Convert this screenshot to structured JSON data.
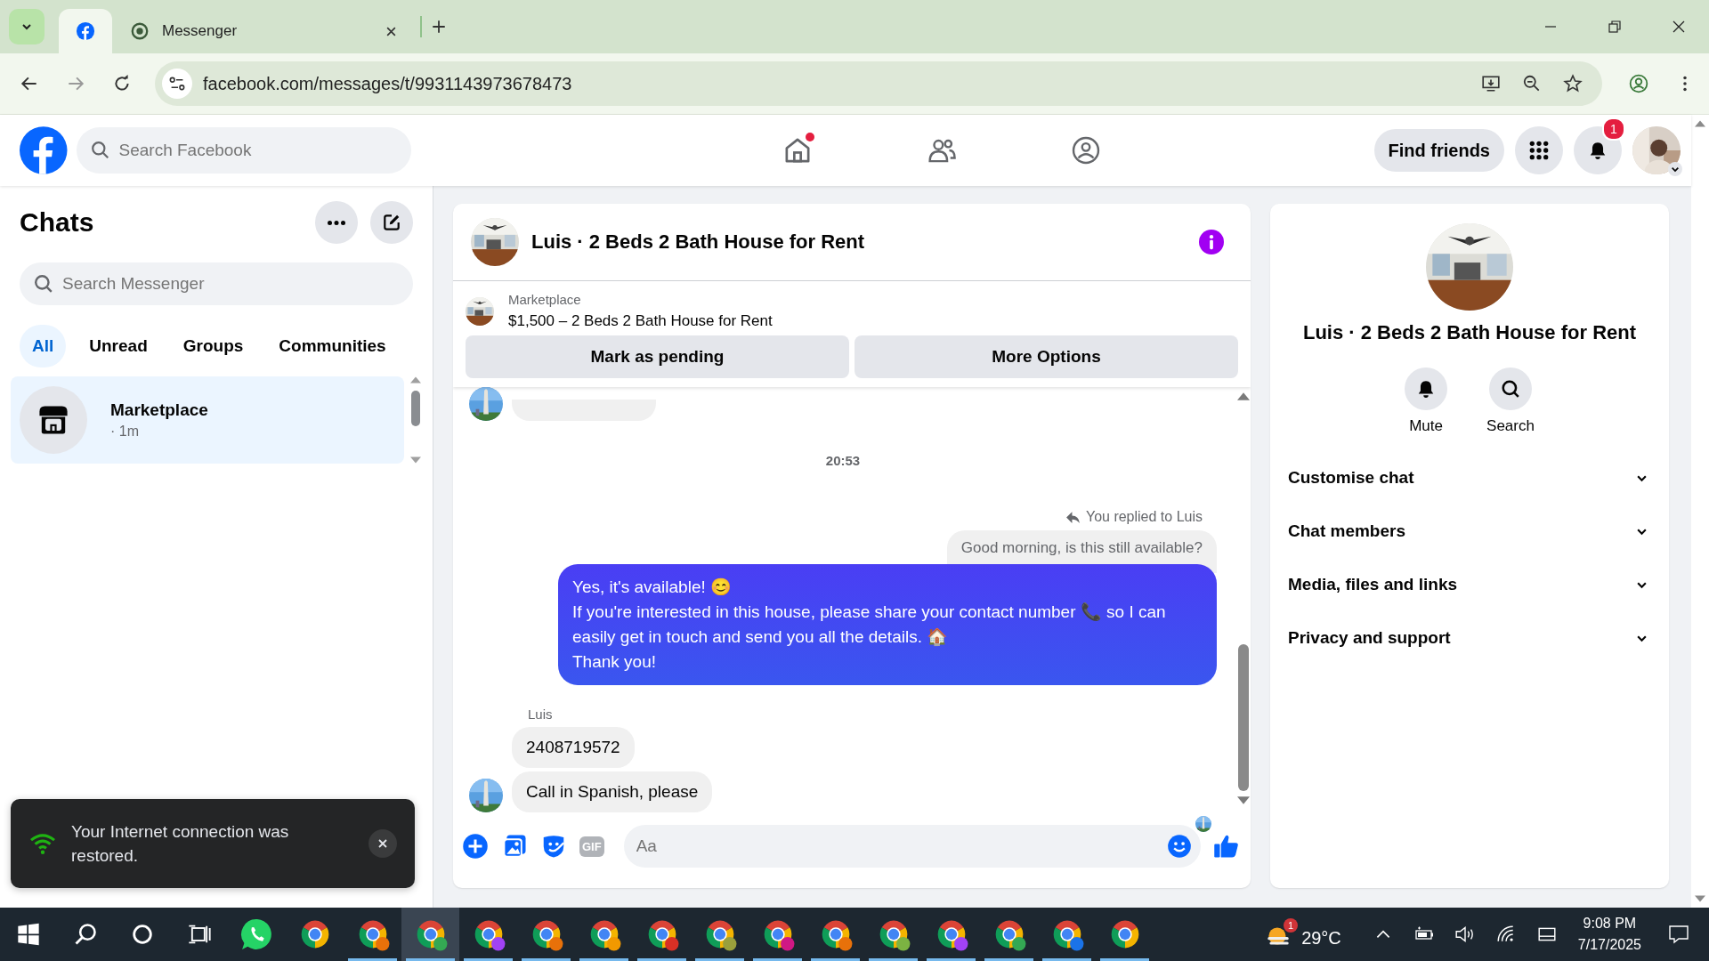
{
  "browser": {
    "tabs": [
      {
        "kind": "facebook",
        "selected": true
      },
      {
        "kind": "messenger",
        "label": "Messenger",
        "selected": false
      }
    ],
    "url": "facebook.com/messages/t/9931143973678473"
  },
  "header": {
    "search_placeholder": "Search Facebook",
    "nav": [
      {
        "kind": "home",
        "dot": true
      },
      {
        "kind": "friends",
        "dot": false
      },
      {
        "kind": "groups",
        "dot": false
      }
    ],
    "find_friends": "Find friends",
    "notification_count": "1"
  },
  "chats": {
    "title": "Chats",
    "search_placeholder": "Search Messenger",
    "filters": [
      {
        "label": "All",
        "selected": true
      },
      {
        "label": "Unread",
        "selected": false
      },
      {
        "label": "Groups",
        "selected": false
      },
      {
        "label": "Communities",
        "selected": false
      }
    ],
    "conversations": [
      {
        "name": "Marketplace",
        "time": "· 1m",
        "selected": true
      }
    ]
  },
  "toast": {
    "text": "Your Internet connection was restored."
  },
  "conversation": {
    "title": "Luis · 2 Beds 2 Bath House for Rent",
    "listing": {
      "source": "Marketplace",
      "title": "$1,500 – 2 Beds 2 Bath House for Rent"
    },
    "actions": [
      "Mark as pending",
      "More Options"
    ],
    "timestamp": "20:53",
    "reply_note": "You replied to Luis",
    "quoted": "Good morning, is this still available?",
    "sent": [
      "Yes, it's available! 😊",
      "If you're interested in this house, please share your contact number 📞 so I can easily get in touch and send you all the details. 🏠",
      "Thank you!"
    ],
    "sender": "Luis",
    "received": [
      "2408719572",
      "Call in Spanish, please"
    ],
    "composer_placeholder": "Aa",
    "gif_label": "GIF"
  },
  "details": {
    "title": "Luis · 2 Beds 2 Bath House for Rent",
    "actions": [
      {
        "kind": "mute",
        "label": "Mute"
      },
      {
        "kind": "search",
        "label": "Search"
      }
    ],
    "sections": [
      "Customise chat",
      "Chat members",
      "Media, files and links",
      "Privacy and support"
    ]
  },
  "taskbar": {
    "apps": [
      {
        "kind": "whatsapp",
        "open": false,
        "selected": false
      },
      {
        "kind": "chrome",
        "open": false,
        "selected": false
      },
      {
        "kind": "chrome",
        "color": "#e8710a",
        "open": true,
        "selected": false
      },
      {
        "kind": "chrome",
        "color": "#34a853",
        "open": true,
        "selected": true
      },
      {
        "kind": "chrome",
        "color": "#a142f4",
        "open": true,
        "selected": false
      },
      {
        "kind": "chrome",
        "color": "#e8710a",
        "open": true,
        "selected": false
      },
      {
        "kind": "chrome",
        "color": "#f29900",
        "open": true,
        "selected": false
      },
      {
        "kind": "chrome",
        "color": "#d93025",
        "open": true,
        "selected": false
      },
      {
        "kind": "chrome",
        "color": "#9aa03c",
        "open": true,
        "selected": false
      },
      {
        "kind": "chrome",
        "color": "#d01884",
        "open": true,
        "selected": false
      },
      {
        "kind": "chrome",
        "color": "#e8710a",
        "open": true,
        "selected": false
      },
      {
        "kind": "chrome",
        "color": "#7cb342",
        "open": true,
        "selected": false
      },
      {
        "kind": "chrome",
        "color": "#a142f4",
        "open": true,
        "selected": false
      },
      {
        "kind": "chrome",
        "color": "#34a853",
        "open": true,
        "selected": false
      },
      {
        "kind": "chrome",
        "color": "#1a73e8",
        "open": true,
        "selected": false
      },
      {
        "kind": "chrome",
        "open": true,
        "selected": false
      }
    ],
    "weather_badge": "1",
    "temperature": "29°C",
    "time": "9:08 PM",
    "date": "7/17/2025"
  }
}
